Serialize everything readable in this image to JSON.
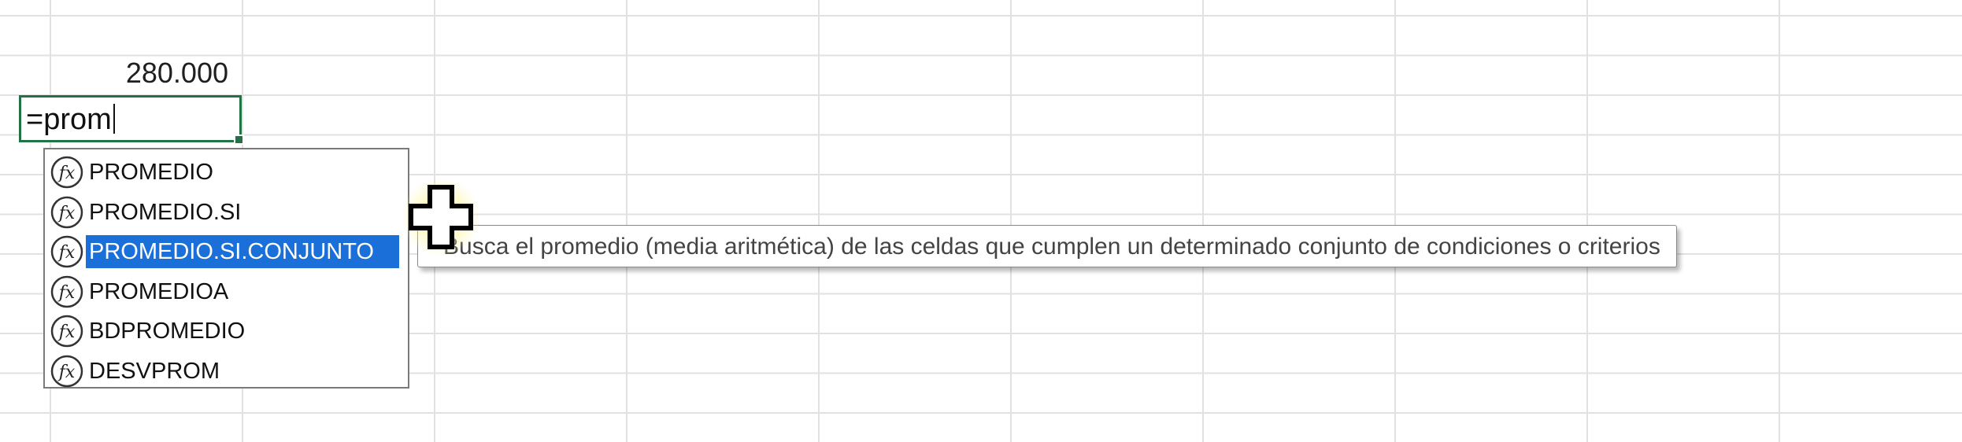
{
  "sheet": {
    "above_cell_value": "280.000",
    "formula_input": "=prom"
  },
  "autocomplete": {
    "items": [
      {
        "label": "PROMEDIO",
        "selected": false
      },
      {
        "label": "PROMEDIO.SI",
        "selected": false
      },
      {
        "label": "PROMEDIO.SI.CONJUNTO",
        "selected": true
      },
      {
        "label": "PROMEDIOA",
        "selected": false
      },
      {
        "label": "BDPROMEDIO",
        "selected": false
      },
      {
        "label": "DESVPROM",
        "selected": false
      }
    ],
    "icon": "function-fx-icon"
  },
  "tooltip": {
    "text": "Busca el promedio (media aritmética) de las celdas que cumplen un determinado conjunto de condiciones o criterios"
  },
  "cursor": {
    "icon": "plus-crosshair-cursor-icon"
  },
  "colors": {
    "gridline": "#e1e1e1",
    "active_cell_border": "#217346",
    "selection": "#1a6fd8",
    "selection_text": "#ffffff"
  }
}
